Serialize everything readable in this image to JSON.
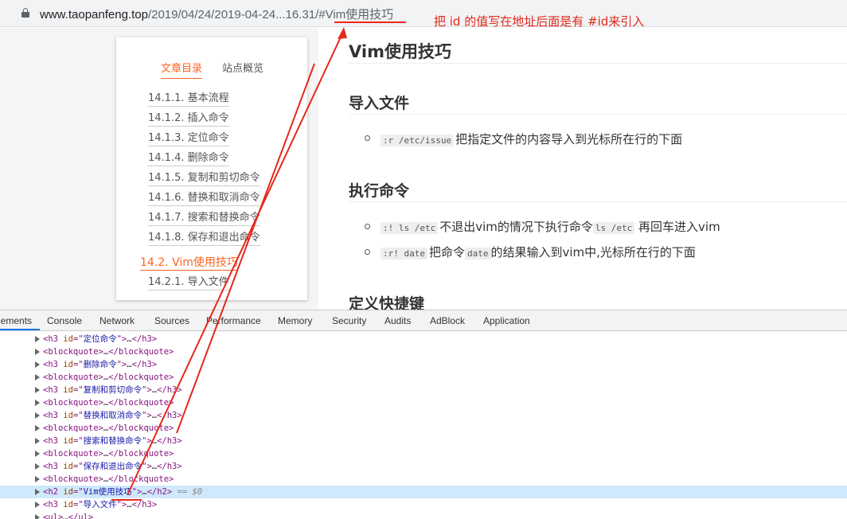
{
  "address_bar": {
    "url_host": "www.taopanfeng.top",
    "url_path": "/2019/04/24/2019-04-24...16.31/#Vim使用技巧"
  },
  "annotation": {
    "text": "把 id 的值写在地址后面是有 #id来引入",
    "color": "#e5281c"
  },
  "toc": {
    "tabs": [
      {
        "label": "文章目录",
        "active": true
      },
      {
        "label": "站点概览",
        "active": false
      }
    ],
    "items": [
      {
        "label": "14.1.1. 基本流程"
      },
      {
        "label": "14.1.2. 插入命令"
      },
      {
        "label": "14.1.3. 定位命令"
      },
      {
        "label": "14.1.4. 删除命令"
      },
      {
        "label": "14.1.5. 复制和剪切命令"
      },
      {
        "label": "14.1.6. 替换和取消命令"
      },
      {
        "label": "14.1.7. 搜索和替换命令"
      },
      {
        "label": "14.1.8. 保存和退出命令"
      },
      {
        "label": "14.2. Vim使用技巧",
        "active": true
      },
      {
        "label": "14.2.1. 导入文件"
      }
    ],
    "accent_color": "#fc6423"
  },
  "content": {
    "title": "Vim使用技巧",
    "sections": [
      {
        "heading": "导入文件",
        "items": [
          {
            "code1": ":r /etc/issue",
            "text1": "把指定文件的内容导入到光标所在行的下面"
          }
        ]
      },
      {
        "heading": "执行命令",
        "items": [
          {
            "code1": ":! ls /etc",
            "text1": "不退出vim的情况下执行命令",
            "code2": "ls /etc",
            "text2": " 再回车进入vim"
          },
          {
            "code1": ":r! date",
            "text1": "把命令",
            "code2": "date",
            "text2": "的结果输入到vim中,光标所在行的下面"
          }
        ]
      },
      {
        "heading": "定义快捷键",
        "items": []
      }
    ]
  },
  "devtools": {
    "tabs": [
      "Elements",
      "Console",
      "Network",
      "Sources",
      "Performance",
      "Memory",
      "Security",
      "Audits",
      "AdBlock",
      "Application"
    ],
    "active_tab": "Elements",
    "rows": [
      {
        "tag": "h3",
        "id": "定位命令"
      },
      {
        "tag": "blockquote"
      },
      {
        "tag": "h3",
        "id": "删除命令"
      },
      {
        "tag": "blockquote"
      },
      {
        "tag": "h3",
        "id": "复制和剪切命令"
      },
      {
        "tag": "blockquote"
      },
      {
        "tag": "h3",
        "id": "替换和取消命令"
      },
      {
        "tag": "blockquote"
      },
      {
        "tag": "h3",
        "id": "搜索和替换命令"
      },
      {
        "tag": "blockquote"
      },
      {
        "tag": "h3",
        "id": "保存和退出命令"
      },
      {
        "tag": "blockquote"
      },
      {
        "tag": "h2",
        "id": "Vim使用技巧",
        "selected": true,
        "note": "== $0"
      },
      {
        "tag": "h3",
        "id": "导入文件"
      },
      {
        "tag": "ul"
      }
    ],
    "selection_color": "#cfe8fc"
  }
}
